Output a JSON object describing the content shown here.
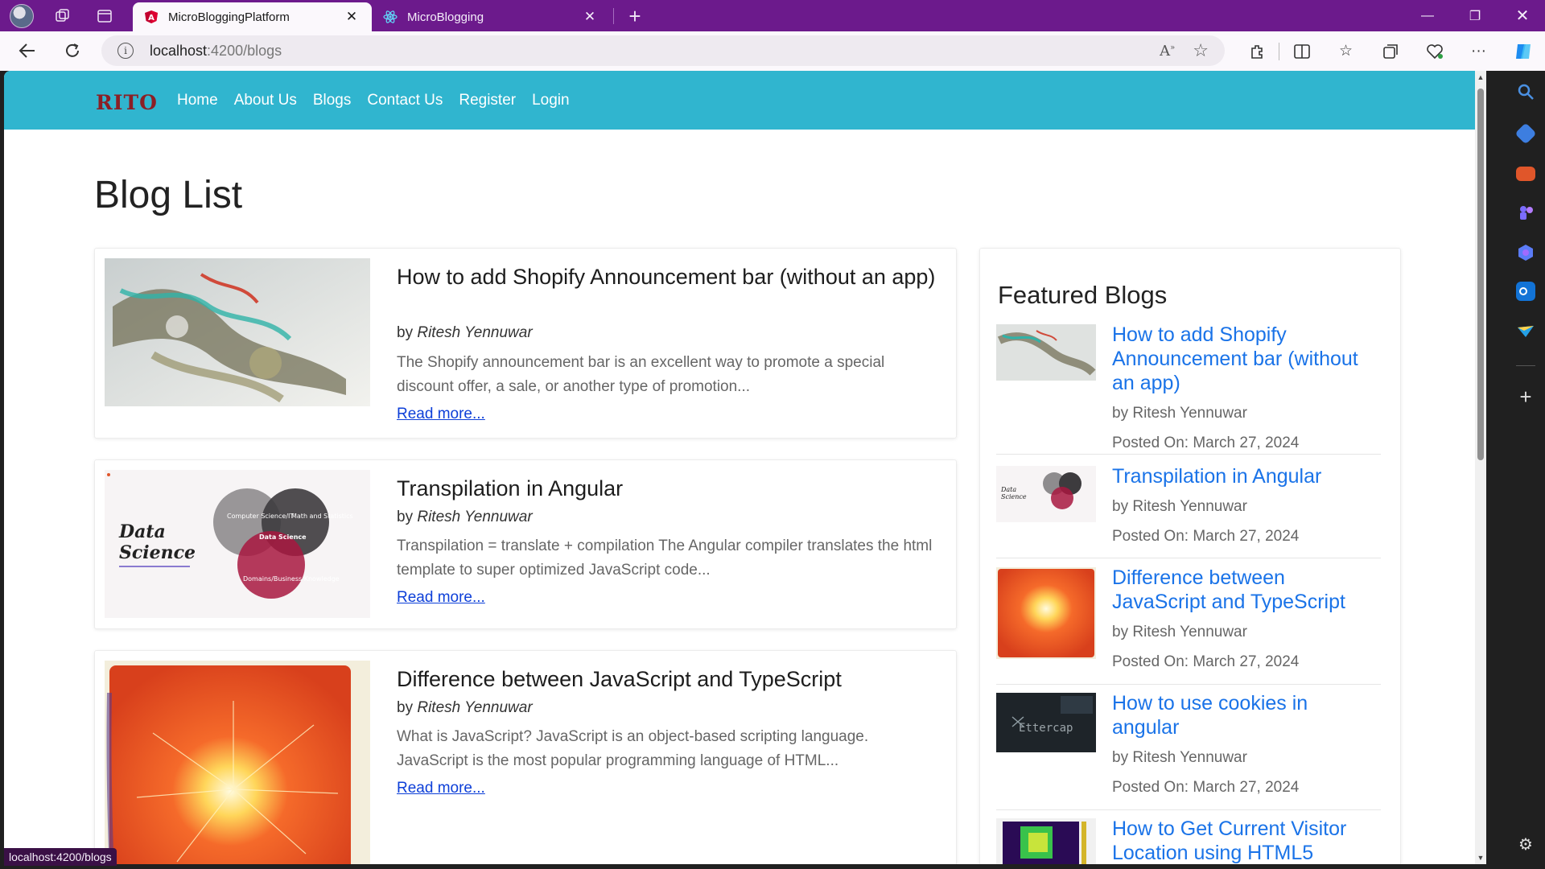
{
  "browser": {
    "tabs": [
      {
        "label": "MicroBloggingPlatform",
        "active": true
      },
      {
        "label": "MicroBlogging",
        "active": false
      }
    ],
    "url_host": "localhost",
    "url_path": ":4200/blogs",
    "status_url": "localhost:4200/blogs",
    "accent": "#6c1a8c"
  },
  "nav": {
    "brand": "RITO",
    "links": [
      "Home",
      "About Us",
      "Blogs",
      "Contact Us",
      "Register",
      "Login"
    ],
    "color": "#30b5cf"
  },
  "page": {
    "title": "Blog List"
  },
  "blogs": [
    {
      "title": "How to add Shopify Announcement bar (without an app)",
      "by": "by",
      "author": "Ritesh Yennuwar",
      "excerpt": "The Shopify announcement bar is an excellent way to promote a special discount offer, a sale, or another type of promotion...",
      "read_more": "Read more..."
    },
    {
      "title": "Transpilation in Angular",
      "by": "by",
      "author": "Ritesh Yennuwar",
      "excerpt": "Transpilation = translate + compilation The Angular compiler translates the html template to super optimized JavaScript code...",
      "read_more": "Read more..."
    },
    {
      "title": "Difference between JavaScript and TypeScript",
      "by": "by",
      "author": "Ritesh Yennuwar",
      "excerpt": "What is JavaScript? JavaScript is an object-based scripting language. JavaScript is the most popular programming language of HTML...",
      "read_more": "Read more..."
    }
  ],
  "featured": {
    "heading": "Featured Blogs",
    "items": [
      {
        "title": "How to add Shopify Announcement bar (without an app)",
        "by": "by Ritesh Yennuwar",
        "date": "Posted On: March 27, 2024"
      },
      {
        "title": "Transpilation in Angular",
        "by": "by Ritesh Yennuwar",
        "date": "Posted On: March 27, 2024"
      },
      {
        "title": "Difference between JavaScript and TypeScript",
        "by": "by Ritesh Yennuwar",
        "date": "Posted On: March 27, 2024"
      },
      {
        "title": "How to use cookies in angular",
        "by": "by Ritesh Yennuwar",
        "date": "Posted On: March 27, 2024"
      },
      {
        "title": "How to Get Current Visitor Location using HTML5",
        "by": "",
        "date": ""
      }
    ]
  },
  "images": {
    "ds_title_1": "Data",
    "ds_title_2": "Science",
    "ds_cs": "Computer Science/IT",
    "ds_math": "Math and Statistics",
    "ds_center": "Data Science",
    "ds_domain": "Domains/Business Knowledge",
    "ettercap": "Ettercap"
  }
}
